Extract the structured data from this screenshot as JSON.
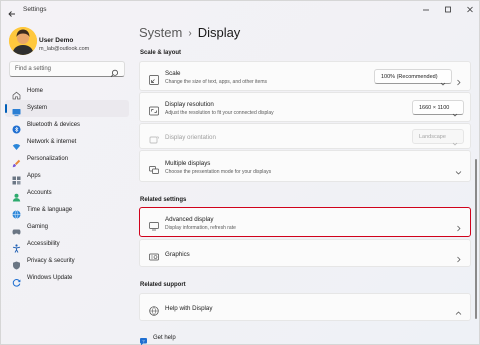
{
  "window": {
    "title": "Settings"
  },
  "user": {
    "name": "User Demo",
    "email": "m_lab@outlook.com"
  },
  "search": {
    "placeholder": "Find a setting"
  },
  "nav": {
    "items": [
      {
        "label": "Home",
        "icon": "home-icon"
      },
      {
        "label": "System",
        "icon": "system-icon",
        "active": true
      },
      {
        "label": "Bluetooth & devices",
        "icon": "bluetooth-icon"
      },
      {
        "label": "Network & internet",
        "icon": "network-icon"
      },
      {
        "label": "Personalization",
        "icon": "brush-icon"
      },
      {
        "label": "Apps",
        "icon": "apps-icon"
      },
      {
        "label": "Accounts",
        "icon": "accounts-icon"
      },
      {
        "label": "Time & language",
        "icon": "globe-icon"
      },
      {
        "label": "Gaming",
        "icon": "gaming-icon"
      },
      {
        "label": "Accessibility",
        "icon": "accessibility-icon"
      },
      {
        "label": "Privacy & security",
        "icon": "shield-icon"
      },
      {
        "label": "Windows Update",
        "icon": "update-icon"
      }
    ]
  },
  "breadcrumb": {
    "parent": "System",
    "separator": "›",
    "current": "Display"
  },
  "sections": {
    "scale_layout": "Scale & layout",
    "related_settings": "Related settings",
    "related_support": "Related support"
  },
  "settings": {
    "scale": {
      "title": "Scale",
      "subtitle": "Change the size of text, apps, and other items",
      "value": "100% (Recommended)"
    },
    "resolution": {
      "title": "Display resolution",
      "subtitle": "Adjust the resolution to fit your connected display",
      "value": "1660 × 1100"
    },
    "orientation": {
      "title": "Display orientation",
      "value": "Landscape"
    },
    "multiple": {
      "title": "Multiple displays",
      "subtitle": "Choose the presentation mode for your displays"
    },
    "advanced": {
      "title": "Advanced display",
      "subtitle": "Display information, refresh rate"
    },
    "graphics": {
      "title": "Graphics"
    },
    "help_display": {
      "title": "Help with Display"
    }
  },
  "footer": {
    "get_help": "Get help"
  },
  "colors": {
    "accent": "#005fb8",
    "highlight_border": "#d0021b"
  }
}
